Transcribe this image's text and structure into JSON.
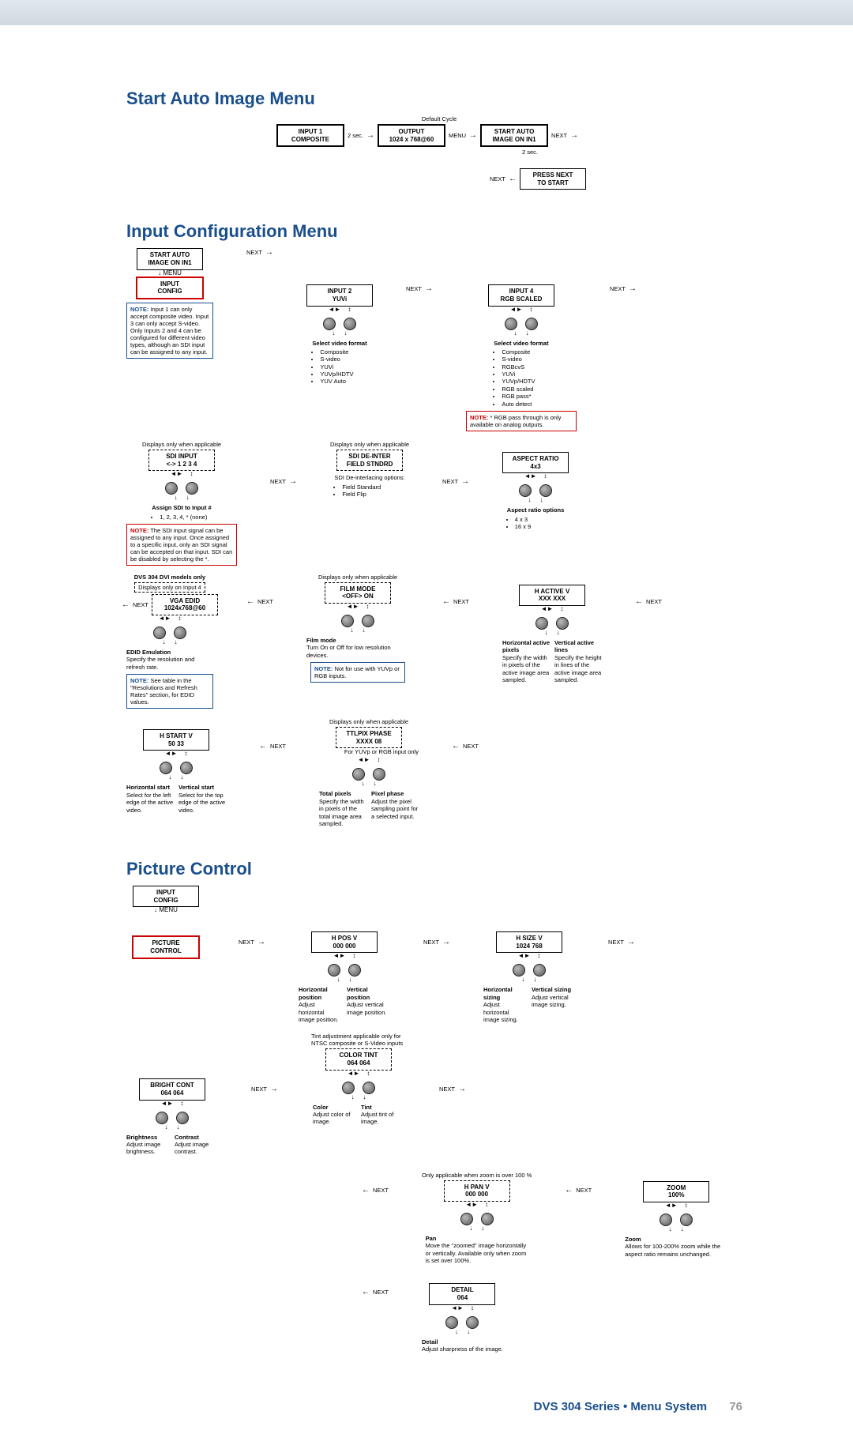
{
  "footer": {
    "series": "DVS 304 Series • Menu System",
    "page": "76"
  },
  "labels": {
    "next": "NEXT",
    "menu": "MENU",
    "twosec": "2 sec."
  },
  "section1": {
    "title": "Start Auto Image Menu",
    "default_cycle": "Default Cycle",
    "input1": "INPUT 1\nCOMPOSITE",
    "output": "OUTPUT\n1024 x 768@60",
    "start_auto": "START AUTO\nIMAGE ON IN1",
    "press_next": "PRESS NEXT\nTO START"
  },
  "section2": {
    "title": "Input Configuration Menu",
    "start_auto_top": "START AUTO\nIMAGE ON IN1",
    "input_config": "INPUT\nCONFIG",
    "displays_only": "Displays only when applicable",
    "input2": "INPUT 2\nYUVi",
    "input4": "INPUT 4\nRGB SCALED",
    "sdi_input": "SDI INPUT\n<->  1 2 3 4",
    "sdi_deinter": "SDI DE-INTER\nFIELD STNDRD",
    "aspect_ratio": "ASPECT RATIO\n4x3",
    "note_input1": "Input 1 can only accept composite video. Input 3 can only accept S-video. Only Inputs 2 and 4 can be configured for different video types, although an SDI input can be assigned to any input.",
    "svf_header": "Select video format",
    "svf_input2": [
      "Composite",
      "S-video",
      "YUVi",
      "YUVp/HDTV",
      "YUV Auto"
    ],
    "svf_input4": [
      "Composite",
      "S-video",
      "RGBcvS",
      "YUVi",
      "YUVp/HDTV",
      "RGB scaled",
      "RGB pass*",
      "Auto detect"
    ],
    "rgb_pass_note": "* RGB pass through is only available on analog outputs.",
    "assign_header": "Assign SDI to Input #",
    "assign_items": [
      "1, 2, 3, 4, * (none)"
    ],
    "sdi_note": "The SDI input signal can be  assigned to any input. Once assigned to a specific input, only an SDI signal can be accepted on that input. SDI can be disabled by selecting the *.",
    "sdi_de_opts_label": "SDI De-interlacing options:",
    "sdi_de_opts": [
      "Field Standard",
      "Field Flip"
    ],
    "ar_header": "Aspect ratio options",
    "ar_items": [
      "4 x 3",
      "16 x 9"
    ],
    "dvs_only": "DVS 304 DVI models only",
    "displays_on_i4": "Displays only on Input 4",
    "vga_edid": "VGA EDID\n1024x768@60",
    "edid_header": "EDID Emulation",
    "edid_desc": "Specify the resolution and refresh rate.",
    "edid_note": "See table in the \"Resolutions and Refresh Rates\" section, for EDID values.",
    "film_mode": "FILM MODE\n<OFF> ON",
    "film_header": "Film mode",
    "film_desc": "Turn On or Off for low resolution devices.",
    "film_note": "Not for use with YUVp or RGB inputs.",
    "hactive": "H  ACTIVE  V\nXXX   XXX",
    "ha_h_head": "Horizontal active pixels",
    "ha_h_desc": "Specify the width in pixels of the active image area sampled.",
    "ha_v_head": "Vertical active lines",
    "ha_v_desc": "Specify the height in lines of the active image area sampled.",
    "hstart": "H  START  V\n50      33",
    "hs_h_head": "Horizontal start",
    "hs_h_desc": "Select for the left edge of the active video.",
    "hs_v_head": "Vertical start",
    "hs_v_desc": "Select for the top edge of the active video.",
    "ttlpix": "TTLPIX PHASE\nXXXX   08",
    "ttl_note": "For YUVp or RGB input only",
    "tot_head": "Total pixels",
    "tot_desc": "Specify the width in pixels of the total image area sampled.",
    "ph_head": "Pixel phase",
    "ph_desc": "Adjust the pixel sampling point for a selected input."
  },
  "section3": {
    "title": "Picture Control",
    "input_config": "INPUT\nCONFIG",
    "picture_control": "PICTURE\nCONTROL",
    "hpos": "H   POS   V\n000   000",
    "hpos_h_head": "Horizontal position",
    "hpos_h_desc": "Adjust horizontal image position.",
    "hpos_v_head": "Vertical position",
    "hpos_v_desc": "Adjust vertical image position.",
    "hsize": "H   SIZE   V\n1024   768",
    "hsize_h_head": "Horizontal sizing",
    "hsize_h_desc": "Adjust horizontal image sizing.",
    "hsize_v_head": "Vertical sizing",
    "hsize_v_desc": "Adjust vertical image sizing.",
    "bright": "BRIGHT CONT\n064   064",
    "br_head": "Brightness",
    "br_desc": "Adjust image brightness.",
    "ct_head": "Contrast",
    "ct_desc": "Adjust image contrast.",
    "tint_top": "Tint adjustment applicable only for NTSC composite or S-Video inputs",
    "color": "COLOR    TINT\n064     064",
    "col_head": "Color",
    "col_desc": "Adjust color of image.",
    "tint_head": "Tint",
    "tint_desc": "Adjust tint of image.",
    "pan_top": "Only applicable when zoom is over 100 %",
    "hpan": "H   PAN   V\n000   000",
    "pan_head": "Pan",
    "pan_desc": "Move the \"zoomed\" image horizontally or vertically.  Available only when zoom is set over 100%.",
    "zoom": "ZOOM\n100%",
    "zoom_head": "Zoom",
    "zoom_desc": "Allows for 100-200% zoom while the aspect ratio remains unchanged.",
    "detail": "DETAIL\n064",
    "detail_head": "Detail",
    "detail_desc": "Adjust sharpness of the image."
  }
}
